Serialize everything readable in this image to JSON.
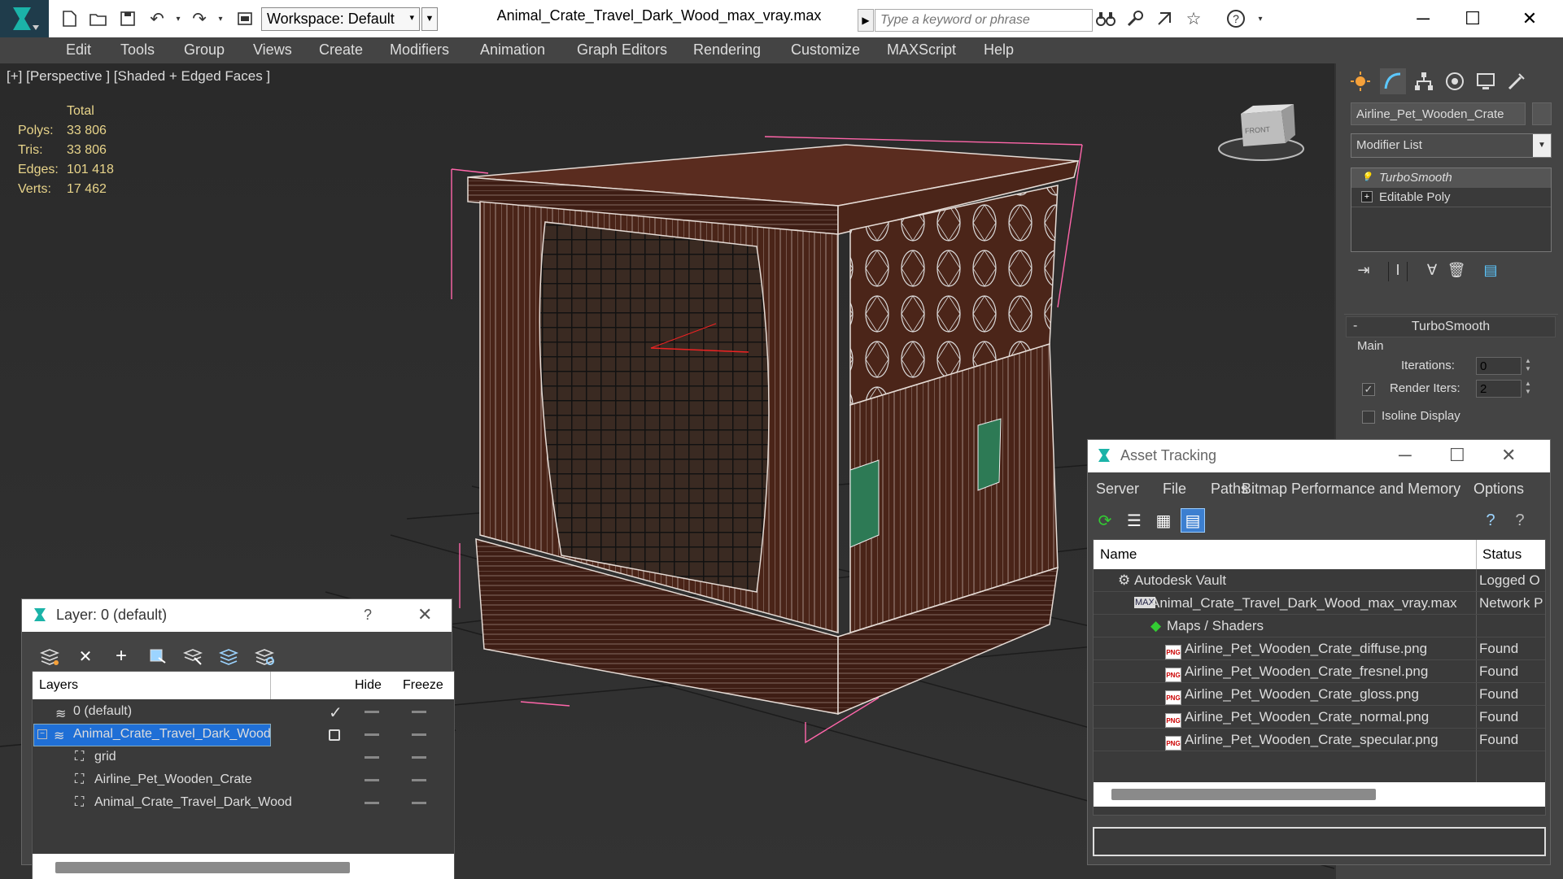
{
  "titlebar": {
    "workspace_label": "Workspace: Default",
    "document_title": "Animal_Crate_Travel_Dark_Wood_max_vray.max",
    "search_placeholder": "Type a keyword or phrase"
  },
  "menu": [
    "Edit",
    "Tools",
    "Group",
    "Views",
    "Create",
    "Modifiers",
    "Animation",
    "Graph Editors",
    "Rendering",
    "Customize",
    "MAXScript",
    "Help"
  ],
  "viewport": {
    "label": "[+] [Perspective ] [Shaded + Edged Faces ]",
    "stats": {
      "header": "Total",
      "rows": [
        {
          "k": "Polys:",
          "v": "33 806"
        },
        {
          "k": "Tris:",
          "v": "33 806"
        },
        {
          "k": "Edges:",
          "v": "101 418"
        },
        {
          "k": "Verts:",
          "v": "17 462"
        }
      ]
    },
    "viewcube_label": "FRONT"
  },
  "command_panel": {
    "object_name": "Airline_Pet_Wooden_Crate",
    "modifier_list": "Modifier List",
    "stack": [
      "TurboSmooth",
      "Editable Poly"
    ],
    "rollout_title": "TurboSmooth",
    "group_main": "Main",
    "iterations_label": "Iterations:",
    "iterations_value": "0",
    "render_iters_label": "Render Iters:",
    "render_iters_value": "2",
    "isoline_label": "Isoline Display"
  },
  "layer_dialog": {
    "title": "Layer: 0 (default)",
    "help": "?",
    "columns": {
      "layers": "Layers",
      "hide": "Hide",
      "freeze": "Freeze"
    },
    "rows": [
      {
        "name": "0 (default)"
      },
      {
        "name": "Animal_Crate_Travel_Dark_Wood"
      },
      {
        "name": "grid"
      },
      {
        "name": "Airline_Pet_Wooden_Crate"
      },
      {
        "name": "Animal_Crate_Travel_Dark_Wood"
      }
    ]
  },
  "asset_tracking": {
    "title": "Asset Tracking",
    "menu": [
      "Server",
      "File",
      "Paths",
      "Bitmap Performance and Memory",
      "Options"
    ],
    "columns": {
      "name": "Name",
      "status": "Status"
    },
    "rows": [
      {
        "name": "Autodesk Vault",
        "status": "Logged O"
      },
      {
        "name": "Animal_Crate_Travel_Dark_Wood_max_vray.max",
        "status": "Network P"
      },
      {
        "name": "Maps / Shaders",
        "status": ""
      },
      {
        "name": "Airline_Pet_Wooden_Crate_diffuse.png",
        "status": "Found"
      },
      {
        "name": "Airline_Pet_Wooden_Crate_fresnel.png",
        "status": "Found"
      },
      {
        "name": "Airline_Pet_Wooden_Crate_gloss.png",
        "status": "Found"
      },
      {
        "name": "Airline_Pet_Wooden_Crate_normal.png",
        "status": "Found"
      },
      {
        "name": "Airline_Pet_Wooden_Crate_specular.png",
        "status": "Found"
      }
    ],
    "png_badge": "PNG"
  }
}
